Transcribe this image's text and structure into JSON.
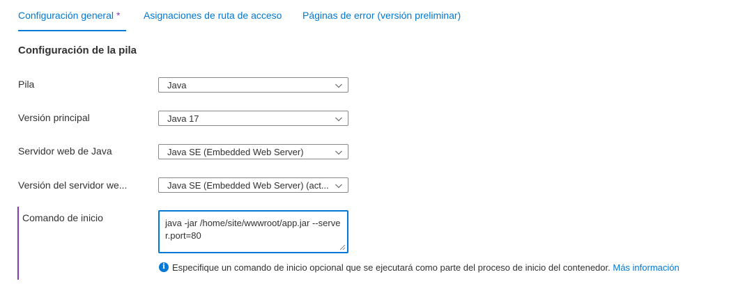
{
  "tabs": [
    {
      "label": "Configuración general",
      "modified_marker": "*"
    },
    {
      "label": "Asignaciones de ruta de acceso"
    },
    {
      "label": "Páginas de error (versión preliminar)"
    }
  ],
  "section_title": "Configuración de la pila",
  "fields": {
    "stack": {
      "label": "Pila",
      "value": "Java"
    },
    "major_version": {
      "label": "Versión principal",
      "value": "Java 17"
    },
    "web_server": {
      "label": "Servidor web de Java",
      "value": "Java SE (Embedded Web Server)"
    },
    "web_server_version": {
      "label": "Versión del servidor we...",
      "value": "Java SE (Embedded Web Server) (act..."
    },
    "startup_command": {
      "label": "Comando de inicio",
      "value": "java -jar /home/site/wwwroot/app.jar --server.port=80"
    }
  },
  "hint": {
    "icon": "info-icon",
    "text": "Especifique un comando de inicio opcional que se ejecutará como parte del proceso de inicio del contenedor.",
    "link": "Más información"
  },
  "colors": {
    "accent": "#0078d4",
    "modified": "#8a3ab9",
    "text": "#323130",
    "border": "#8a8886"
  }
}
